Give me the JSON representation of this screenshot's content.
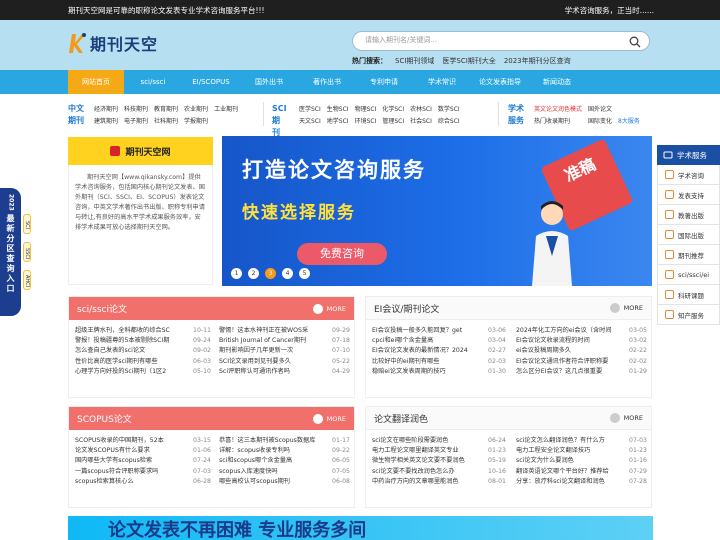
{
  "topbar": {
    "left": "期刊天空网是可靠的职称论文发表专业学术咨询服务平台!!!",
    "right": "学术咨询服务，正当时......"
  },
  "logo": {
    "name": "期刊天空"
  },
  "search": {
    "placeholder": "请输入期刊名/关键词..."
  },
  "hot": {
    "label": "热门搜索：",
    "items": [
      "SCI期刊领域",
      "医学SCI期刊大全",
      "2023年期刊分区查询"
    ]
  },
  "nav": [
    "网站首页",
    "sci/ssci",
    "EI/SCOPUS",
    "国外出书",
    "著作出书",
    "专利申请",
    "学术常识",
    "论文发表指导",
    "新闻动态"
  ],
  "cats": {
    "cn": {
      "title": [
        "中文",
        "期刊"
      ],
      "links": [
        "经济期刊",
        "科技期刊",
        "教育期刊",
        "农业期刊",
        "工业期刊",
        "建筑期刊",
        "电子期刊",
        "社科期刊",
        "学报期刊"
      ]
    },
    "sci": {
      "title": [
        "SCI期",
        "刊"
      ],
      "links": [
        "医学SCI",
        "生物SCI",
        "物理SCI",
        "化学SCI",
        "农林SCI",
        "数学SCI",
        "天文SCI",
        "地学SCI",
        "环境SCI",
        "管理SCI",
        "社会SCI",
        "综合SCI"
      ]
    },
    "svc": {
      "title": [
        "学术",
        "服务"
      ],
      "links": [
        "英文论文润色模式",
        "国外论文",
        "热门收录期刊",
        "国际变化",
        "8大服务"
      ]
    }
  },
  "intro": {
    "title": "期刊天空网",
    "text": "期刊天空网【www.qikansky.com】提供学术咨询服务，包括国内核心期刊论文发表、国外期刊（SCI、SSCI、EI、SCOPUS）发表论文咨询，中英文学术著作出书出版、职称专利申请与转让,有良好的高水平学术成果服务效率，安排学术成果可放心选择期刊天空网。"
  },
  "banner": {
    "line1": "打造论文咨询服务",
    "line2": "快速选择服务",
    "button": "免费咨询",
    "stamp": "准稿",
    "dots": [
      "1",
      "2",
      "3",
      "4",
      "5"
    ],
    "active_dot": 3
  },
  "panels": {
    "sci": {
      "title": "sci/ssci论文",
      "more": "MORE",
      "rows": [
        {
          "t": "超级王牌水刊，全科都收的综合SC",
          "d": "10-11"
        },
        {
          "t": "警惕！这本水神刊正在被WOS采",
          "d": "09-29"
        },
        {
          "t": "警报！投稿疆尊的5本被剔除SCI期",
          "d": "09-24"
        },
        {
          "t": "British Journal of Cancer期刊",
          "d": "07-18"
        },
        {
          "t": "怎么查自己发表的sci论文",
          "d": "09-02"
        },
        {
          "t": "期刊影响因子几年更新一次",
          "d": "07-10"
        },
        {
          "t": "性价比高的医学sci期刊有哪些",
          "d": "06-03"
        },
        {
          "t": "SCI论文录用到见刊要多久",
          "d": "05-22"
        },
        {
          "t": "心理学方向好投的Sci期刊（1区2",
          "d": "05-10"
        },
        {
          "t": "Sci评职称认可通讯作者吗",
          "d": "04-29"
        }
      ]
    },
    "ei": {
      "title": "EI会议/期刊论文",
      "more": "MORE",
      "rows": [
        {
          "t": "EI会议投稿一般多久能回复？get",
          "d": "03-06"
        },
        {
          "t": "2024年化工方向的ei会议（含时间",
          "d": "03-05"
        },
        {
          "t": "cpci和ei哪个含金量高",
          "d": "03-04"
        },
        {
          "t": "EI会议论文收录流程的时间",
          "d": "03-02"
        },
        {
          "t": "EI会议论文发表的最新情况？2024",
          "d": "02-27"
        },
        {
          "t": "ei会议投稿周期多久",
          "d": "02-22"
        },
        {
          "t": "比较好中的ei期刊有哪些",
          "d": "02-03"
        },
        {
          "t": "EI会议论文通讯作者符合评职称要",
          "d": "02-02"
        },
        {
          "t": "稳赔ei论文发表周期的技巧",
          "d": "01-30"
        },
        {
          "t": "怎么区分EI会议？这几点很重要",
          "d": "01-29"
        }
      ]
    },
    "scopus": {
      "title": "SCOPUS论文",
      "more": "MORE",
      "rows": [
        {
          "t": "SCOPUS收录的中国期刊，52本",
          "d": "03-15"
        },
        {
          "t": "恭喜！这三本期刊被Scopus数据库",
          "d": "01-17"
        },
        {
          "t": "论文发SCOPUS有什么要求",
          "d": "01-06"
        },
        {
          "t": "详解：scopus收录专利吗",
          "d": "09-22"
        },
        {
          "t": "国内哪些大学有scopus检索",
          "d": "07-24"
        },
        {
          "t": "sci和scopus哪个含金量高",
          "d": "06-05"
        },
        {
          "t": "一篇scopus符合评职称要求吗",
          "d": "07-03"
        },
        {
          "t": "scopus入库速度快吗",
          "d": "07-05"
        },
        {
          "t": "scopus检索算核心么",
          "d": "06-28"
        },
        {
          "t": "哪些高校认可scopus期刊",
          "d": "06-08"
        }
      ]
    },
    "trans": {
      "title": "论文翻译润色",
      "more": "MORE",
      "rows": [
        {
          "t": "sci论文在哪些阶段需要润色",
          "d": "06-24"
        },
        {
          "t": "sci论文怎么翻译润色？有什么方",
          "d": "07-03"
        },
        {
          "t": "电力工程论文哪里翻译英文专业",
          "d": "01-23"
        },
        {
          "t": "电力工程安全论文翻译技巧",
          "d": "01-23"
        },
        {
          "t": "微生物学相关英文论文要不要润色",
          "d": "05-19"
        },
        {
          "t": "sci论文为什么要润色",
          "d": "01-16"
        },
        {
          "t": "sci论文要不要找改润色怎么办",
          "d": "10-16"
        },
        {
          "t": "翻译英语论文哪个平台好？推荐给",
          "d": "07-29"
        },
        {
          "t": "中药治疗方向的文章哪里能润色",
          "d": "08-01"
        },
        {
          "t": "分享：放疗科sci论文翻译和润色",
          "d": "07-28"
        }
      ]
    }
  },
  "sidebar": {
    "head": "学术服务",
    "items": [
      "学术咨询",
      "发表支持",
      "教著出版",
      "国际出版",
      "期刊推荐",
      "sci/ssci/ei",
      "科研课题",
      "知产服务"
    ]
  },
  "vbadge": {
    "year": "2023",
    "text": "最新分区查询入口"
  },
  "vtabs": [
    "SCI",
    "SSCI",
    "AHCI"
  ],
  "bottom": {
    "text": "论文发表不再困难 专业服务多间"
  }
}
